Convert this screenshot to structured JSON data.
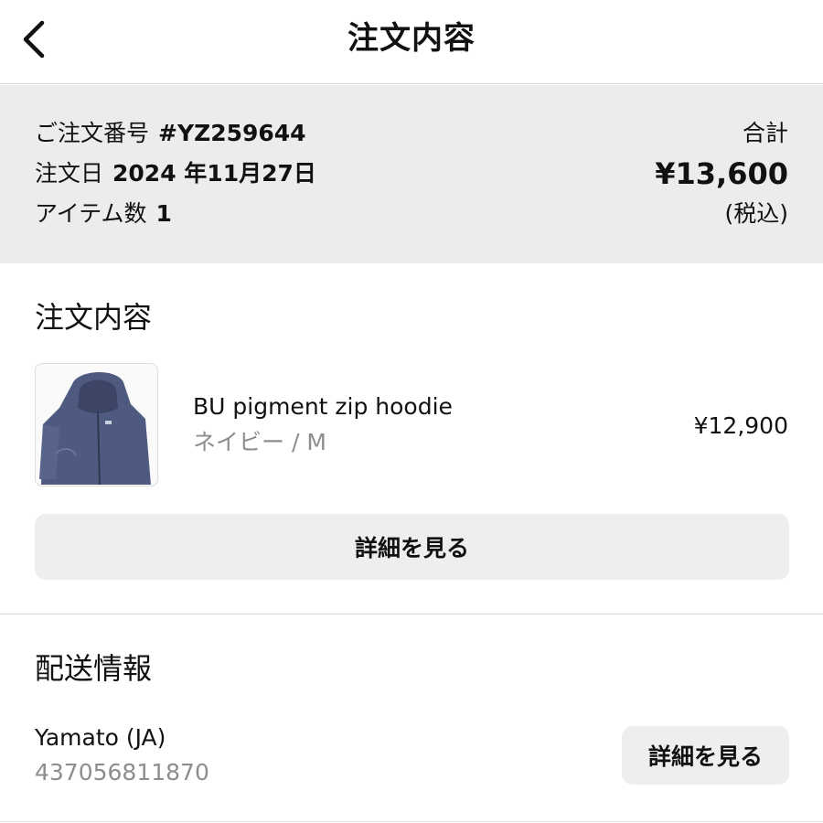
{
  "header": {
    "title": "注文内容",
    "back_icon": "chevron-left-icon"
  },
  "summary": {
    "order_number_label": "ご注文番号",
    "order_number": "#YZ259644",
    "order_date_label": "注文日",
    "order_date": "2024 年11月27日",
    "item_count_label": "アイテム数",
    "item_count": "1",
    "total_label": "合計",
    "total_amount": "¥13,600",
    "tax_note": "(税込)"
  },
  "order": {
    "section_title": "注文内容",
    "items": [
      {
        "name": "BU pigment zip hoodie",
        "variant": "ネイビー / M",
        "price": "¥12,900",
        "image": "navy-zip-hoodie-image"
      }
    ],
    "detail_button_label": "詳細を見る"
  },
  "shipping": {
    "section_title": "配送情報",
    "carrier": "Yamato (JA)",
    "tracking_number": "437056811870",
    "detail_button_label": "詳細を見る"
  },
  "colors": {
    "summary_background": "#ececec",
    "button_background": "#eeeeee",
    "muted_text": "#8d8d8d",
    "hoodie": "#4f5a80"
  }
}
